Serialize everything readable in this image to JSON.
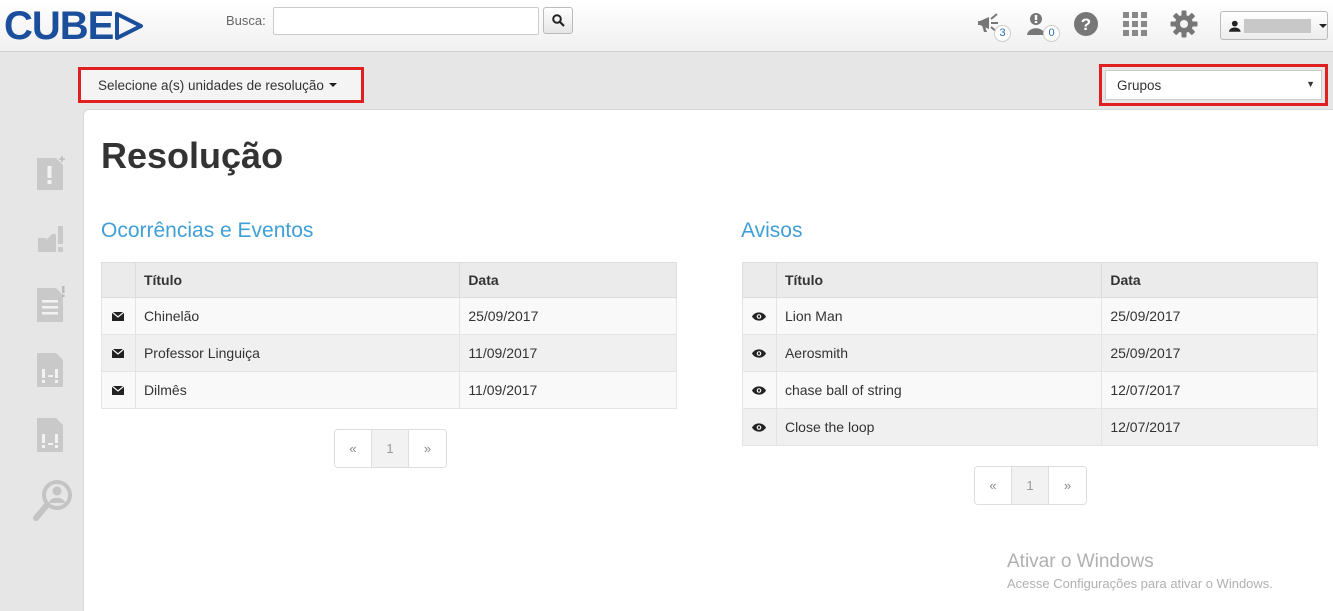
{
  "header": {
    "logo_text": "CUBE",
    "search_label": "Busca:",
    "search_value": "",
    "notifications": [
      {
        "icon": "megaphone-icon",
        "count": "3"
      },
      {
        "icon": "alert-user-icon",
        "count": "0"
      }
    ]
  },
  "toolbar": {
    "unit_dropdown_label": "Selecione a(s) unidades de resolução",
    "groups_select_value": "Grupos"
  },
  "sidebar": {
    "items": [
      {
        "icon": "new-occurrence-icon"
      },
      {
        "icon": "occurrence-icon"
      },
      {
        "icon": "document-alert-icon"
      },
      {
        "icon": "report-icon"
      },
      {
        "icon": "report-alt-icon"
      },
      {
        "icon": "search-user-icon"
      }
    ]
  },
  "main": {
    "title": "Resolução",
    "occurrences": {
      "title": "Ocorrências e Eventos",
      "columns": [
        "Título",
        "Data"
      ],
      "rows": [
        {
          "icon": "envelope-icon",
          "title": "Chinelão",
          "date": "25/09/2017"
        },
        {
          "icon": "envelope-icon",
          "title": "Professor Linguiça",
          "date": "11/09/2017"
        },
        {
          "icon": "envelope-icon",
          "title": "Dilmês",
          "date": "11/09/2017"
        }
      ],
      "pager": {
        "prev": "«",
        "page": "1",
        "next": "»"
      }
    },
    "notices": {
      "title": "Avisos",
      "columns": [
        "Título",
        "Data"
      ],
      "rows": [
        {
          "icon": "eye-icon",
          "title": "Lion Man",
          "date": "25/09/2017"
        },
        {
          "icon": "eye-icon",
          "title": "Aerosmith",
          "date": "25/09/2017"
        },
        {
          "icon": "eye-icon",
          "title": "chase ball of string",
          "date": "12/07/2017"
        },
        {
          "icon": "eye-icon",
          "title": "Close the loop",
          "date": "12/07/2017"
        }
      ],
      "pager": {
        "prev": "«",
        "page": "1",
        "next": "»"
      }
    }
  },
  "watermark": {
    "title": "Ativar o Windows",
    "subtitle": "Acesse Configurações para ativar o Windows."
  },
  "colors": {
    "brand": "#1b4f9c",
    "section_title": "#3f9fd6",
    "highlight_border": "#e02020"
  }
}
